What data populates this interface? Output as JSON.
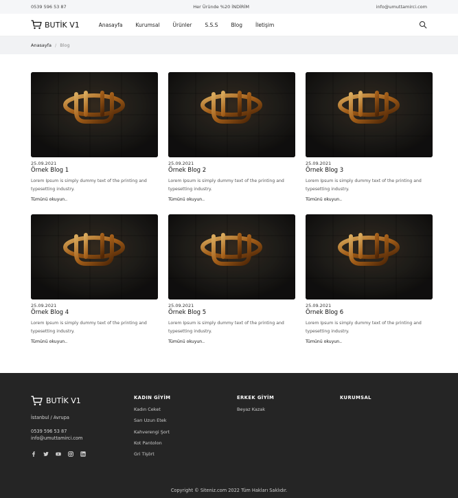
{
  "topbar": {
    "phone": "0539 596 53 87",
    "promo": "Her Üründe %20 İNDİRİM",
    "email": "info@umuttamirci.com"
  },
  "header": {
    "brand": "BUTİK V1",
    "nav": [
      "Anasayfa",
      "Kurumsal",
      "Ürünler",
      "S.S.S",
      "Blog",
      "İletişim"
    ]
  },
  "breadcrumb": {
    "home": "Anasayfa",
    "separator": "/",
    "current": "Blog"
  },
  "blog": {
    "posts": [
      {
        "date": "25.09.2021",
        "title": "Örnek Blog 1",
        "excerpt": "Lorem Ipsum is simply dummy text of the printing and typesetting industry.",
        "more": "Tümünü okuyun.."
      },
      {
        "date": "25.09.2021",
        "title": "Örnek Blog 2",
        "excerpt": "Lorem Ipsum is simply dummy text of the printing and typesetting industry.",
        "more": "Tümünü okuyun.."
      },
      {
        "date": "25.09.2021",
        "title": "Örnek Blog 3",
        "excerpt": "Lorem Ipsum is simply dummy text of the printing and typesetting industry.",
        "more": "Tümünü okuyun.."
      },
      {
        "date": "25.09.2021",
        "title": "Örnek Blog 4",
        "excerpt": "Lorem Ipsum is simply dummy text of the printing and typesetting industry.",
        "more": "Tümünü okuyun.."
      },
      {
        "date": "25.09.2021",
        "title": "Örnek Blog 5",
        "excerpt": "Lorem Ipsum is simply dummy text of the printing and typesetting industry.",
        "more": "Tümünü okuyun.."
      },
      {
        "date": "25.09.2021",
        "title": "Örnek Blog 6",
        "excerpt": "Lorem Ipsum is simply dummy text of the printing and typesetting industry.",
        "more": "Tümünü okuyun.."
      }
    ]
  },
  "footer": {
    "brand": "BUTİK V1",
    "location": "İstanbul / Avrupa",
    "phone": "0539 596 53 87",
    "email": "info@umuttamirci.com",
    "socials": [
      "facebook-icon",
      "twitter-icon",
      "youtube-icon",
      "instagram-icon",
      "linkedin-icon"
    ],
    "women": {
      "heading": "KADIN GİYİM",
      "items": [
        "Kadın Ceket",
        "Sarı Uzun Etek",
        "Kahverengi Şort",
        "Kot Pantolon",
        "Gri Tişört"
      ]
    },
    "men": {
      "heading": "ERKEK GİYİM",
      "items": [
        "Beyaz Kazak"
      ]
    },
    "corporate": {
      "heading": "KURUMSAL"
    },
    "copyright": "Copyright © Siteniz.com 2022 Tüm Hakları Saklıdır."
  },
  "colors": {
    "footer_bg": "#252525",
    "topbar_bg": "#f5f6f8",
    "breadcrumb_bg": "#f1f2f4",
    "thumb_glow": "#d98a2e"
  }
}
